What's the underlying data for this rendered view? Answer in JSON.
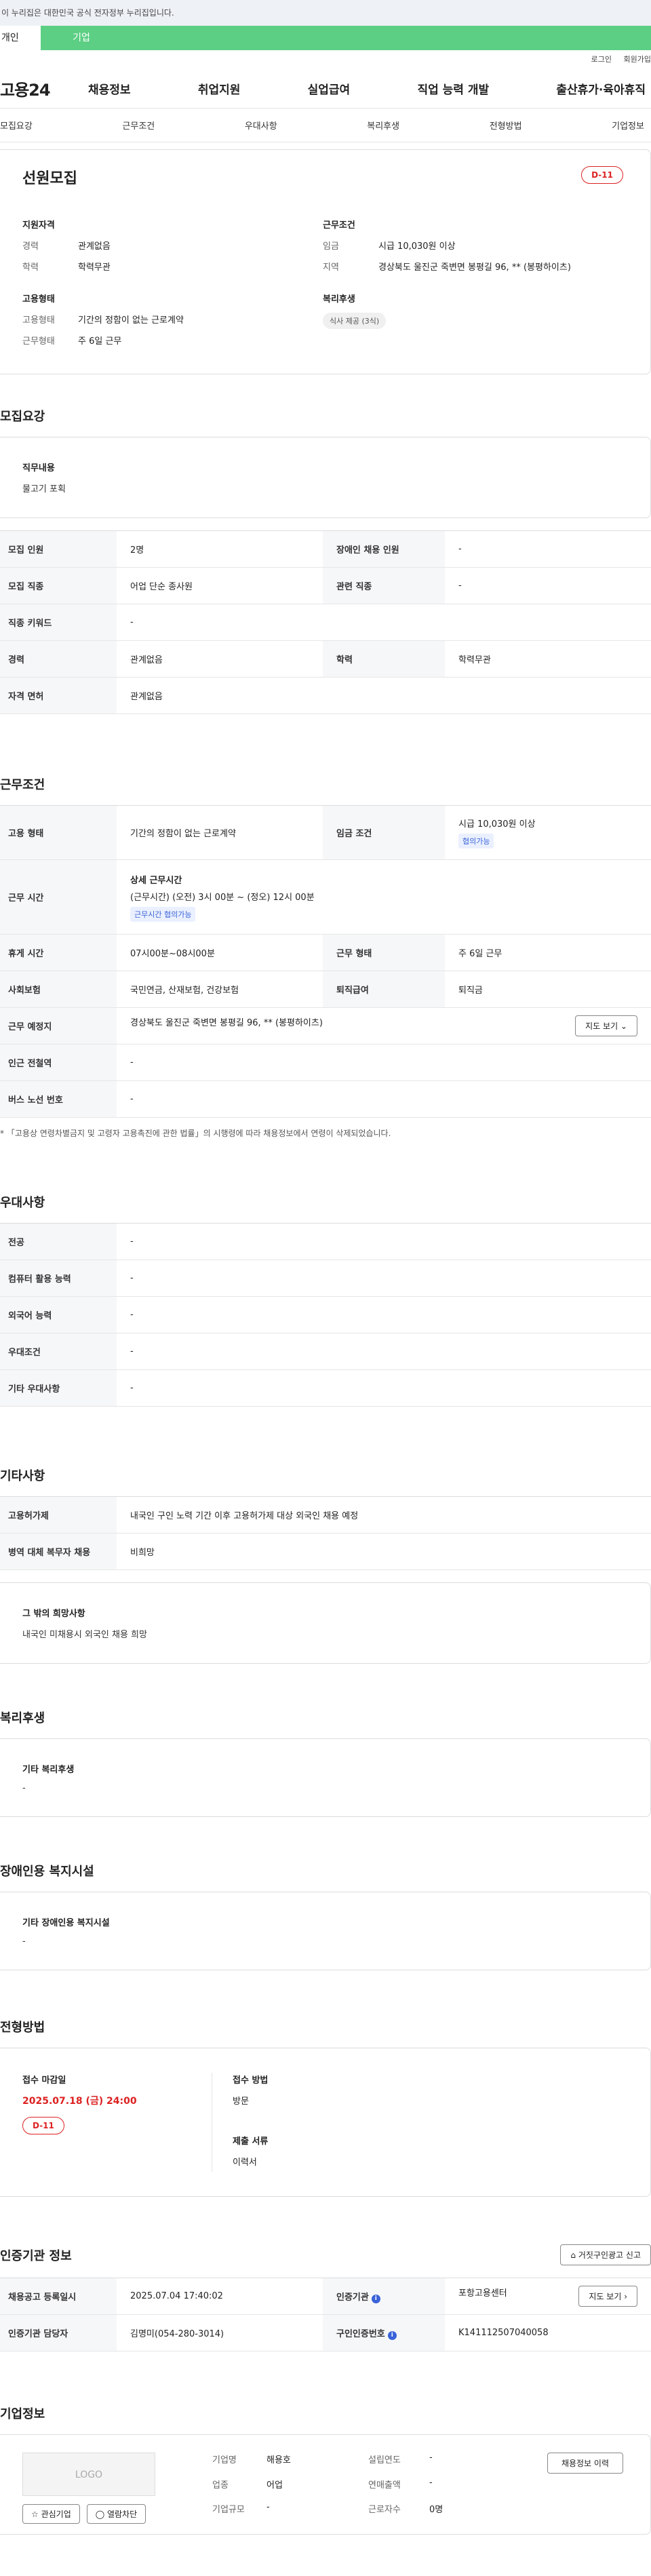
{
  "notice": "이 누리집은 대한민국 공식 전자정부 누리집입니다.",
  "top_tabs": {
    "personal": "개인",
    "company": "기업"
  },
  "util": {
    "login": "로그인",
    "signup": "회원가입"
  },
  "gnb": {
    "logo": "고용24",
    "menu": [
      "채용정보",
      "취업지원",
      "실업급여",
      "직업 능력 개발",
      "출산휴가·육아휴직"
    ]
  },
  "lnb": [
    "모집요강",
    "근무조건",
    "우대사항",
    "복리후생",
    "전형방법",
    "기업정보"
  ],
  "summary": {
    "title": "선원모집",
    "dday": "D-11",
    "qual_title": "지원자격",
    "qual": [
      {
        "k": "경력",
        "v": "관계없음"
      },
      {
        "k": "학력",
        "v": "학력무관"
      }
    ],
    "cond_title": "근무조건",
    "cond": [
      {
        "k": "임금",
        "v": "시급 10,030원 이상"
      },
      {
        "k": "지역",
        "v": "경상북도 울진군 죽변면 봉평길 96, ** (봉평하이츠)"
      }
    ],
    "emp_title": "고용형태",
    "emp": [
      {
        "k": "고용형태",
        "v": "기간의 정함이 없는 근로계약"
      },
      {
        "k": "근무형태",
        "v": "주 6일 근무"
      }
    ],
    "welfare_title": "복리후생",
    "welfare_chip": "식사 제공 (3식)"
  },
  "recruit": {
    "title": "모집요강",
    "duty_label": "직무내용",
    "duty_value": "물고기 포획",
    "rows": [
      [
        "모집 인원",
        "2명",
        "장애인 채용 인원",
        "-"
      ],
      [
        "모집 직종",
        "어업 단순 종사원",
        "관련 직종",
        "-"
      ],
      [
        "직종 키워드",
        "-"
      ],
      [
        "경력",
        "관계없음",
        "학력",
        "학력무관"
      ],
      [
        "자격 면허",
        "관계없음"
      ]
    ]
  },
  "work": {
    "title": "근무조건",
    "emp_type_k": "고용 형태",
    "emp_type_v": "기간의 정함이 없는 근로계약",
    "wage_k": "임금 조건",
    "wage_v": "시급 10,030원 이상",
    "wage_tag": "협의가능",
    "time_k": "근무 시간",
    "time_title": "상세 근무시간",
    "time_v": "(근무시간) (오전) 3시 00분 ~ (정오) 12시 00분",
    "time_tag": "근무시간 협의가능",
    "rest_k": "휴게 시간",
    "rest_v": "07시00분~08시00분",
    "form_k": "근무 형태",
    "form_v": "주 6일 근무",
    "ins_k": "사회보험",
    "ins_v": "국민연금, 산재보험, 건강보험",
    "sev_k": "퇴직급여",
    "sev_v": "퇴직금",
    "place_k": "근무 예정지",
    "place_v": "경상북도 울진군 죽변면 봉평길 96, ** (봉평하이츠)",
    "map_btn": "지도 보기 ⌄",
    "station_k": "인근 전철역",
    "station_v": "-",
    "bus_k": "버스 노선 번호",
    "bus_v": "-",
    "note": "* 「고용상 연령차별금지 및 고령자 고용촉진에 관한 법률」의 시행령에 따라 채용정보에서 연령이 삭제되었습니다."
  },
  "pref": {
    "title": "우대사항",
    "rows": [
      [
        "전공",
        "-"
      ],
      [
        "컴퓨터 활용 능력",
        "-"
      ],
      [
        "외국어 능력",
        "-"
      ],
      [
        "우대조건",
        "-"
      ],
      [
        "기타 우대사항",
        "-"
      ]
    ]
  },
  "etc": {
    "title": "기타사항",
    "rows": [
      [
        "고용허가제",
        "내국인 구인 노력 기간 이후 고용허가제 대상 외국인 채용 예정"
      ],
      [
        "병역 대체 복무자 채용",
        "비희망"
      ]
    ],
    "box_h": "그 밖의 희망사항",
    "box_v": "내국인 미채용시 외국인 채용 희망"
  },
  "welfare": {
    "title": "복리후생",
    "h": "기타 복리후생",
    "v": "-"
  },
  "disabled": {
    "title": "장애인용 복지시설",
    "h": "기타 장애인용 복지시설",
    "v": "-"
  },
  "selection": {
    "title": "전형방법",
    "deadline_h": "접수 마감일",
    "deadline_v": "2025.07.18 (금) 24:00",
    "dday": "D-11",
    "method_h": "접수 방법",
    "method_v": "방문",
    "docs_h": "제출 서류",
    "docs_v": "이력서"
  },
  "cert": {
    "title": "인증기관 정보",
    "report_btn": "⌂ 거짓구인광고 신고",
    "reg_k": "채용공고 등록일시",
    "reg_v": "2025.07.04 17:40:02",
    "org_k": "인증기관",
    "org_v": "포항고용센터",
    "map_btn": "지도 보기 ›",
    "mgr_k": "인증기관 담당자",
    "mgr_v": "김명미(054-280-3014)",
    "no_k": "구인인증번호",
    "no_v": "K141112507040058"
  },
  "company": {
    "title": "기업정보",
    "logo": "LOGO",
    "fav_btn": "☆ 관심기업",
    "hide_btn": "◯ 열람차단",
    "name_k": "기업명",
    "name_v": "해용호",
    "ind_k": "업종",
    "ind_v": "어업",
    "size_k": "기업규모",
    "size_v": "-",
    "year_k": "설립연도",
    "year_v": "-",
    "sales_k": "연매출액",
    "sales_v": "-",
    "emp_k": "근로자수",
    "emp_v": "0명",
    "btn": "채용정보 이력"
  }
}
